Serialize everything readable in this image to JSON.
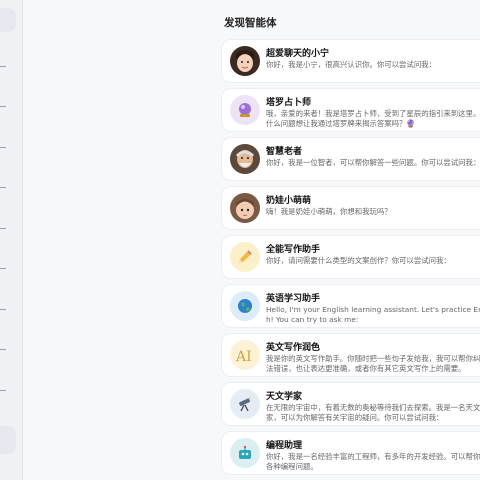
{
  "section_title": "发现智能体",
  "agents": [
    {
      "name": "超爱聊天的小宁",
      "desc": "你好，我是小宁，很高兴认识你。你可以尝试问我：",
      "icon": "girl-avatar-icon",
      "bg": "#fbe3e3"
    },
    {
      "name": "塔罗占卜师",
      "desc": "哦，亲爱的来者！我是塔罗占卜师，受到了星辰的指引来到这里。你有什么问题想让我通过塔罗牌来揭示答案吗？🔮",
      "icon": "crystal-ball-icon",
      "bg": "#eee2f7"
    },
    {
      "name": "智慧老者",
      "desc": "你好，我是一位智者，可以帮你解答一些问题。你可以尝试问我：",
      "icon": "old-man-avatar-icon",
      "bg": "#efe4d8"
    },
    {
      "name": "奶娃小萌萌",
      "desc": "嗨！我是奶娃小萌萌，你想和我玩吗？",
      "icon": "baby-avatar-icon",
      "bg": "#f6e6dc"
    },
    {
      "name": "全能写作助手",
      "desc": "你好，请问需要什么类型的文案创作？你可以尝试问我：",
      "icon": "pencil-icon",
      "bg": "#fbf0c8"
    },
    {
      "name": "英语学习助手",
      "desc": "Hello, I'm your English learning assistant. Let's practice English! You can try to ask me:",
      "icon": "globe-icon",
      "bg": "#dcecf8"
    },
    {
      "name": "英文写作润色",
      "desc": "我是你的英文写作助手。你随时把一些句子发给我，我可以帮你纠正语法错误，也让表达更准确，或者你有其它英文写作上的需要。",
      "icon": "ai-text-icon",
      "bg": "#fdf1d6"
    },
    {
      "name": "天文学家",
      "desc": "在无限的宇宙中，有着无数的奥秘等待我们去探索。我是一名天文学家，可以为你解答有关宇宙的疑问。你可以尝试问我：",
      "icon": "telescope-icon",
      "bg": "#e4ecf6"
    },
    {
      "name": "编程助理",
      "desc": "你好，我是一名经验丰富的工程师，有多年的开发经验。可以帮你解决各种编程问题。",
      "icon": "robot-icon",
      "bg": "#dbeef2"
    }
  ]
}
